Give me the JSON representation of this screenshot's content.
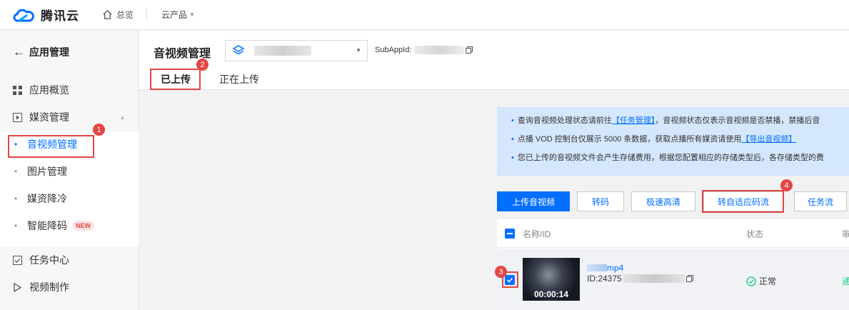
{
  "topbar": {
    "brand": "腾讯云",
    "home_label": "总览",
    "products_label": "云产品"
  },
  "sidebar": {
    "back_label": "应用管理",
    "items": [
      {
        "label": "应用概览"
      },
      {
        "label": "媒资管理"
      },
      {
        "label": "任务中心"
      },
      {
        "label": "视频制作"
      }
    ],
    "sub_items": [
      {
        "label": "音视频管理"
      },
      {
        "label": "图片管理"
      },
      {
        "label": "媒资降冷"
      },
      {
        "label": "智能降码",
        "badge": "NEW"
      }
    ]
  },
  "header": {
    "title": "音视频管理",
    "subappid_label": "SubAppId:",
    "tabs": [
      {
        "label": "已上传"
      },
      {
        "label": "正在上传"
      }
    ]
  },
  "notice": {
    "line1_pre": "查询音视频处理状态请前往",
    "line1_link": "【任务管理】",
    "line1_post": "，音视频状态仅表示音视频是否禁播，禁播后音",
    "line2_pre": "点播 VOD 控制台仅展示 5000 条数据，获取点播所有媒资请使用",
    "line2_link": "【导出音视频】",
    "line3": "您已上传的音视频文件会产生存储费用，根据您配置相应的存储类型后，各存储类型的费"
  },
  "toolbar": {
    "upload": "上传音视频",
    "transcode": "转码",
    "tesla": "极速高清",
    "adaptive": "转自适应码流",
    "taskflow": "任务流"
  },
  "table": {
    "headers": {
      "name": "名称/ID",
      "status": "状态",
      "review": "审"
    },
    "rows": [
      {
        "name_suffix": "mp4",
        "id_prefix": "ID:24375",
        "status": "正常",
        "duration": "00:00:14",
        "review_partial": "通"
      }
    ]
  },
  "steps": [
    "1",
    "2",
    "3",
    "4"
  ],
  "colors": {
    "accent": "#006eff",
    "highlight": "#e54545",
    "ok": "#29cc85"
  }
}
